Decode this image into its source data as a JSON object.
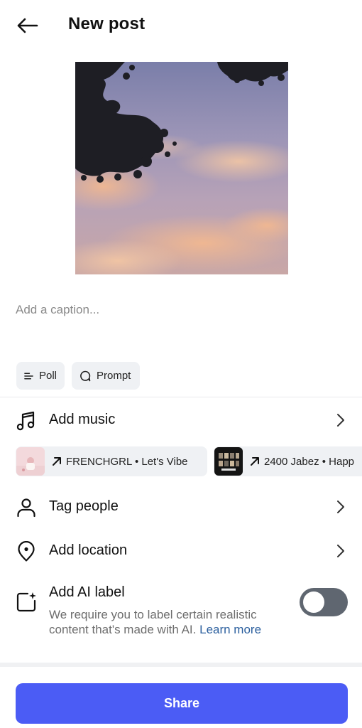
{
  "header": {
    "title": "New post",
    "back_icon": "arrow-left-icon"
  },
  "caption": {
    "placeholder": "Add a caption...",
    "value": ""
  },
  "chips": [
    {
      "label": "Poll",
      "icon": "poll-lines-icon"
    },
    {
      "label": "Prompt",
      "icon": "speech-bubble-icon"
    }
  ],
  "rows": {
    "music": {
      "label": "Add music",
      "icon": "music-note-icon"
    },
    "tag": {
      "label": "Tag people",
      "icon": "person-icon"
    },
    "location": {
      "label": "Add location",
      "icon": "location-pin-icon"
    }
  },
  "music_suggestions": [
    {
      "text": "FRENCHGRL • Let's Vibe"
    },
    {
      "text": "2400 Jabez • Happ"
    }
  ],
  "ai_label": {
    "title": "Add AI label",
    "description": "We require you to label certain realistic content that's made with AI.",
    "learn_more": "Learn more",
    "toggle_on": false
  },
  "share": {
    "label": "Share"
  },
  "colors": {
    "accent": "#4b5cf5",
    "link": "#2b5f9e",
    "toggle_off": "#5f6670"
  }
}
